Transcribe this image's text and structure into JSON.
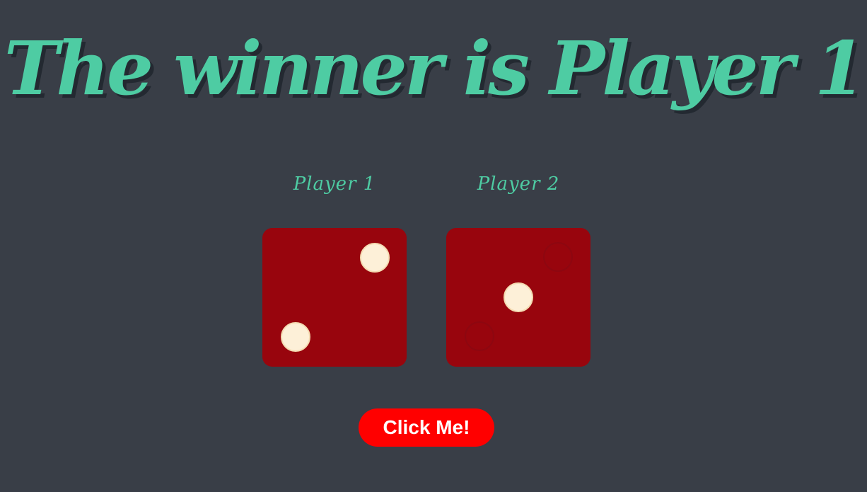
{
  "title": "The winner is Player 1",
  "players": [
    {
      "label": "Player 1",
      "die_value": 2
    },
    {
      "label": "Player 2",
      "die_value": 1
    }
  ],
  "button": {
    "label": "Click Me!"
  },
  "colors": {
    "background": "#393e47",
    "accent": "#4ecca3",
    "die_face": "#98050d",
    "pip": "#fdf0d8",
    "button": "#ff0000"
  }
}
